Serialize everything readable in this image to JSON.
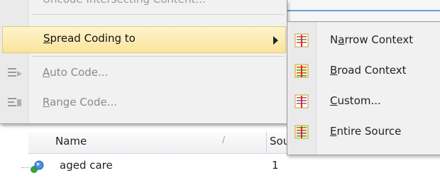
{
  "menu": {
    "top_item_label": "Uncode Intersecting Content...",
    "items": [
      {
        "label": "Spread Coding to",
        "accel_index": 0,
        "state": "highlighted",
        "icon": "none",
        "has_submenu": true
      },
      {
        "label": "Auto Code...",
        "accel_index": 0,
        "state": "disabled",
        "icon": "auto-code-icon"
      },
      {
        "label": "Range Code...",
        "accel_index": 0,
        "state": "disabled",
        "icon": "range-code-icon"
      }
    ]
  },
  "submenu": {
    "items": [
      {
        "label": "Narrow Context",
        "accel_index": 1,
        "icon": "narrow-context-icon"
      },
      {
        "label": "Broad Context",
        "accel_index": 0,
        "icon": "broad-context-icon"
      },
      {
        "label": "Custom...",
        "accel_index": 0,
        "icon": "custom-context-icon"
      },
      {
        "label": "Entire Source",
        "accel_index": 0,
        "icon": "entire-source-icon"
      }
    ]
  },
  "list": {
    "columns": [
      "Name",
      "Sou"
    ],
    "rows": [
      {
        "name": "aged care",
        "sources": "1",
        "icon": "node-icon"
      }
    ]
  }
}
